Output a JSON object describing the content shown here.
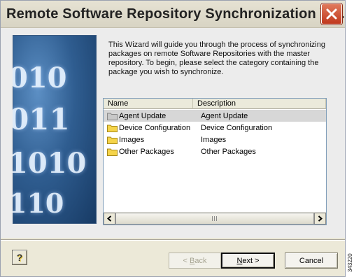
{
  "window": {
    "title": "Remote Software Repository Synchronization W...",
    "close_icon": "close-x-icon"
  },
  "intro": {
    "text": "This Wizard will guide you through the process of synchronizing packages on remote Software Repositories with the master repository. To begin, please select the category containing the package you wish to synchronize."
  },
  "banner": {
    "binary_lines": [
      "010",
      "011",
      "1010",
      "1010",
      "110"
    ]
  },
  "list": {
    "columns": [
      "Name",
      "Description"
    ],
    "rows": [
      {
        "name": "Agent Update",
        "description": "Agent Update",
        "selected": true,
        "icon": "folder-icon-gray"
      },
      {
        "name": "Device Configuration",
        "description": "Device Configuration",
        "selected": false,
        "icon": "folder-icon"
      },
      {
        "name": "Images",
        "description": "Images",
        "selected": false,
        "icon": "folder-icon"
      },
      {
        "name": "Other Packages",
        "description": "Other Packages",
        "selected": false,
        "icon": "folder-icon"
      }
    ]
  },
  "footer": {
    "help_label": "?",
    "back_mnemonic": "B",
    "back_rest": "ack",
    "back_prefix": "< ",
    "next_mnemonic": "N",
    "next_rest": "ext >",
    "cancel_label": "Cancel"
  },
  "figure_id": "343220",
  "colors": {
    "dialog_bg": "#ece9d8",
    "close_button": "#c0381c",
    "selection_gray": "#d7d7d7",
    "folder_yellow": "#f5d44a"
  }
}
